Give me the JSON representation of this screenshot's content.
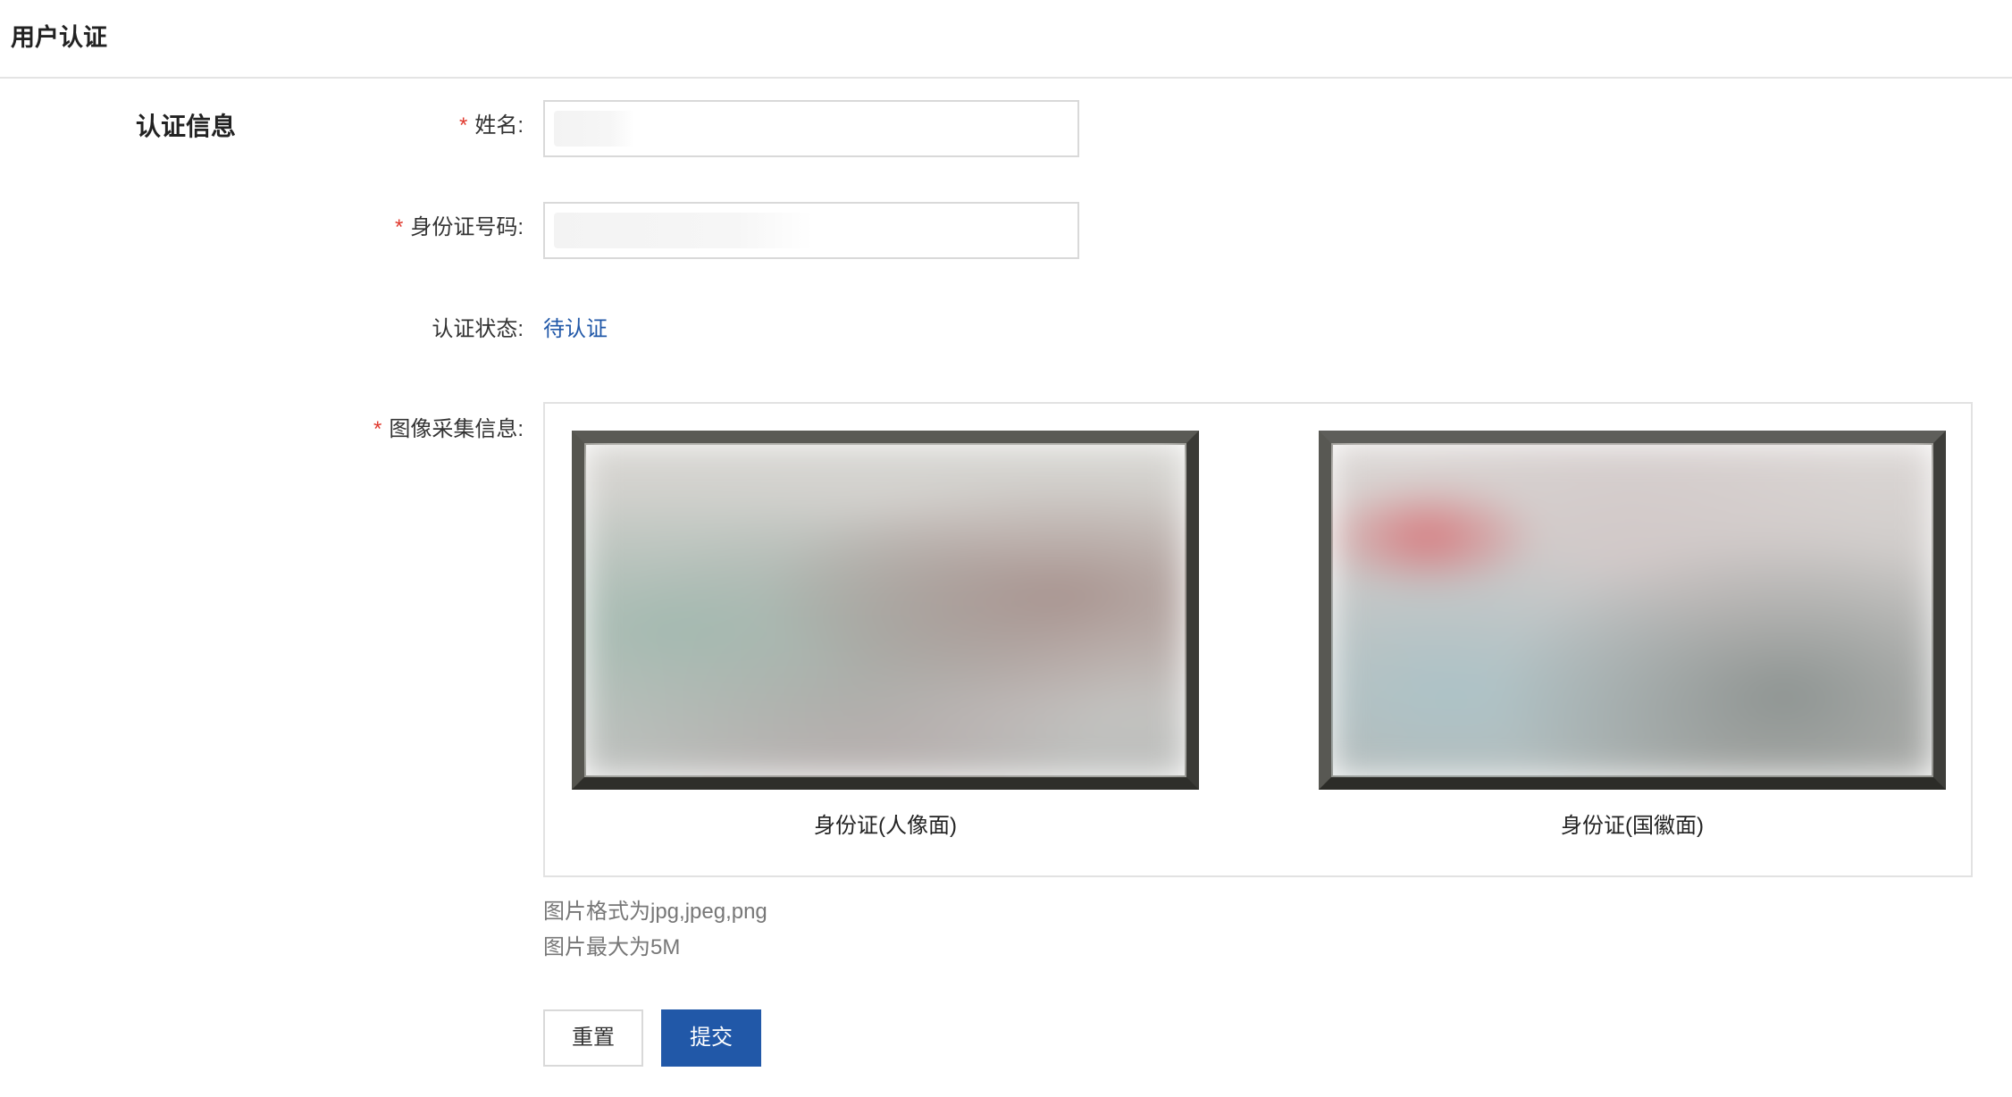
{
  "header": {
    "title": "用户认证"
  },
  "section": {
    "title": "认证信息"
  },
  "form": {
    "name": {
      "required": "*",
      "label": "姓名:",
      "value": ""
    },
    "id_number": {
      "required": "*",
      "label": "身份证号码:",
      "value": ""
    },
    "status": {
      "label": "认证状态:",
      "value": "待认证"
    },
    "images": {
      "required": "*",
      "label": "图像采集信息:",
      "front_caption": "身份证(人像面)",
      "back_caption": "身份证(国徽面)"
    },
    "hints": {
      "format": "图片格式为jpg,jpeg,png",
      "size": "图片最大为5M"
    }
  },
  "actions": {
    "reset_label": "重置",
    "submit_label": "提交"
  },
  "colors": {
    "accent": "#2158a8",
    "required": "#e03a2f",
    "border": "#d9d9d9"
  }
}
